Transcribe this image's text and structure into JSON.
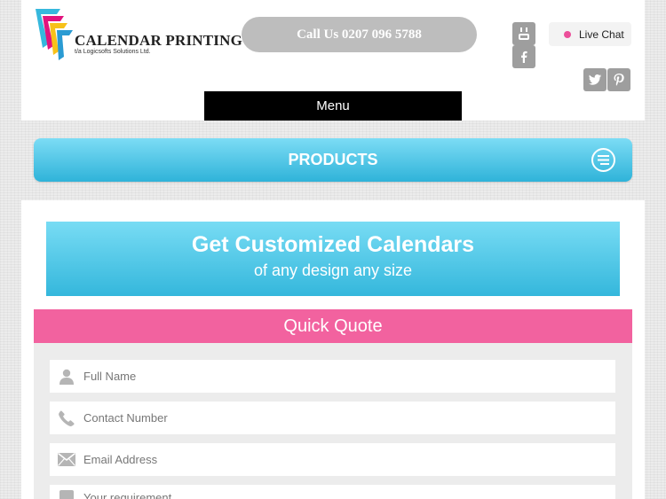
{
  "brand": {
    "name": "CALENDAR PRINTING",
    "tagline": "t/a Logicsofts Solutions Ltd.",
    "colors": {
      "cyan": "#36b8dd",
      "pink": "#f2629f",
      "magenta": "#e2137d",
      "yellow": "#f7c11a"
    }
  },
  "header": {
    "call_label": "Call Us 0207 096 5788",
    "social_icons": [
      "youtube-icon",
      "facebook-icon",
      "twitter-icon",
      "pinterest-icon"
    ],
    "live_chat_label": "Live Chat",
    "menu_label": "Menu"
  },
  "products": {
    "label": "PRODUCTS",
    "icon": "menu-lines-icon"
  },
  "banner": {
    "heading": "Get Customized Calendars",
    "subheading": "of any design any size"
  },
  "quote": {
    "title": "Quick Quote",
    "fields": [
      {
        "icon": "user-icon",
        "placeholder": "Full Name"
      },
      {
        "icon": "phone-icon",
        "placeholder": "Contact Number"
      },
      {
        "icon": "envelope-icon",
        "placeholder": "Email Address"
      },
      {
        "icon": "pencil-icon",
        "placeholder": "Your requirement"
      }
    ]
  }
}
